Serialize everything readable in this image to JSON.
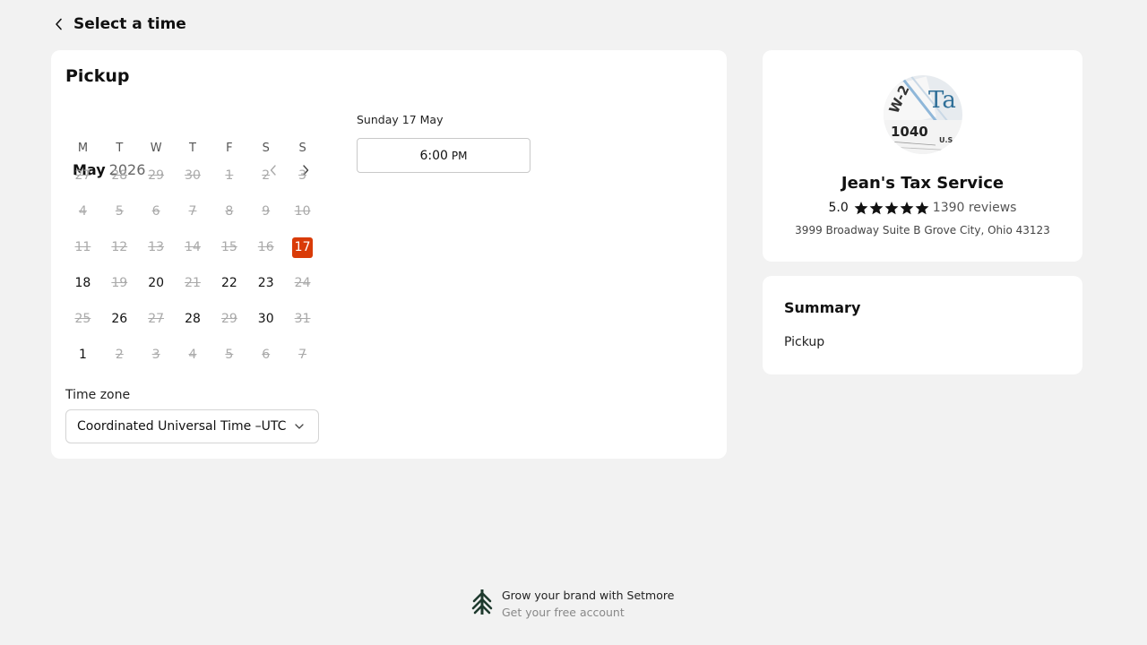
{
  "header": {
    "title": "Select a time"
  },
  "service": {
    "name": "Pickup"
  },
  "calendar": {
    "month": "May",
    "year": "2026",
    "weekdays": [
      "M",
      "T",
      "W",
      "T",
      "F",
      "S",
      "S"
    ],
    "weeks": [
      [
        {
          "d": "27",
          "s": "disabled"
        },
        {
          "d": "28",
          "s": "disabled"
        },
        {
          "d": "29",
          "s": "disabled"
        },
        {
          "d": "30",
          "s": "disabled"
        },
        {
          "d": "1",
          "s": "disabled"
        },
        {
          "d": "2",
          "s": "disabled"
        },
        {
          "d": "3",
          "s": "disabled"
        }
      ],
      [
        {
          "d": "4",
          "s": "disabled"
        },
        {
          "d": "5",
          "s": "disabled"
        },
        {
          "d": "6",
          "s": "disabled"
        },
        {
          "d": "7",
          "s": "disabled"
        },
        {
          "d": "8",
          "s": "disabled"
        },
        {
          "d": "9",
          "s": "disabled"
        },
        {
          "d": "10",
          "s": "disabled"
        }
      ],
      [
        {
          "d": "11",
          "s": "disabled"
        },
        {
          "d": "12",
          "s": "disabled"
        },
        {
          "d": "13",
          "s": "disabled"
        },
        {
          "d": "14",
          "s": "disabled"
        },
        {
          "d": "15",
          "s": "disabled"
        },
        {
          "d": "16",
          "s": "disabled"
        },
        {
          "d": "17",
          "s": "selected"
        }
      ],
      [
        {
          "d": "18",
          "s": "available"
        },
        {
          "d": "19",
          "s": "disabled"
        },
        {
          "d": "20",
          "s": "available"
        },
        {
          "d": "21",
          "s": "disabled"
        },
        {
          "d": "22",
          "s": "available"
        },
        {
          "d": "23",
          "s": "available"
        },
        {
          "d": "24",
          "s": "disabled"
        }
      ],
      [
        {
          "d": "25",
          "s": "disabled"
        },
        {
          "d": "26",
          "s": "available"
        },
        {
          "d": "27",
          "s": "disabled"
        },
        {
          "d": "28",
          "s": "available"
        },
        {
          "d": "29",
          "s": "disabled"
        },
        {
          "d": "30",
          "s": "available"
        },
        {
          "d": "31",
          "s": "disabled"
        }
      ],
      [
        {
          "d": "1",
          "s": "available"
        },
        {
          "d": "2",
          "s": "disabled"
        },
        {
          "d": "3",
          "s": "disabled"
        },
        {
          "d": "4",
          "s": "disabled"
        },
        {
          "d": "5",
          "s": "disabled"
        },
        {
          "d": "6",
          "s": "disabled"
        },
        {
          "d": "7",
          "s": "disabled"
        }
      ]
    ]
  },
  "timezone": {
    "label": "Time zone",
    "value": "Coordinated Universal Time –UTC"
  },
  "slots": {
    "date_label": "Sunday 17 May",
    "items": [
      {
        "time": "6:00",
        "period": "PM"
      }
    ]
  },
  "business": {
    "name": "Jean's Tax Service",
    "rating": "5.0",
    "stars": 5,
    "reviews": "1390 reviews",
    "address": "3999 Broadway Suite B Grove City, Ohio 43123",
    "avatar_text": {
      "form": "W-2",
      "tax": "Ta",
      "num": "1040",
      "us": "U.S"
    }
  },
  "summary": {
    "title": "Summary",
    "item": "Pickup"
  },
  "footer": {
    "promo": "Grow your brand with Setmore",
    "cta": "Get your free account"
  },
  "colors": {
    "accent": "#d93b08",
    "background": "#f2f2f2",
    "logo": "#1f3a2e"
  }
}
